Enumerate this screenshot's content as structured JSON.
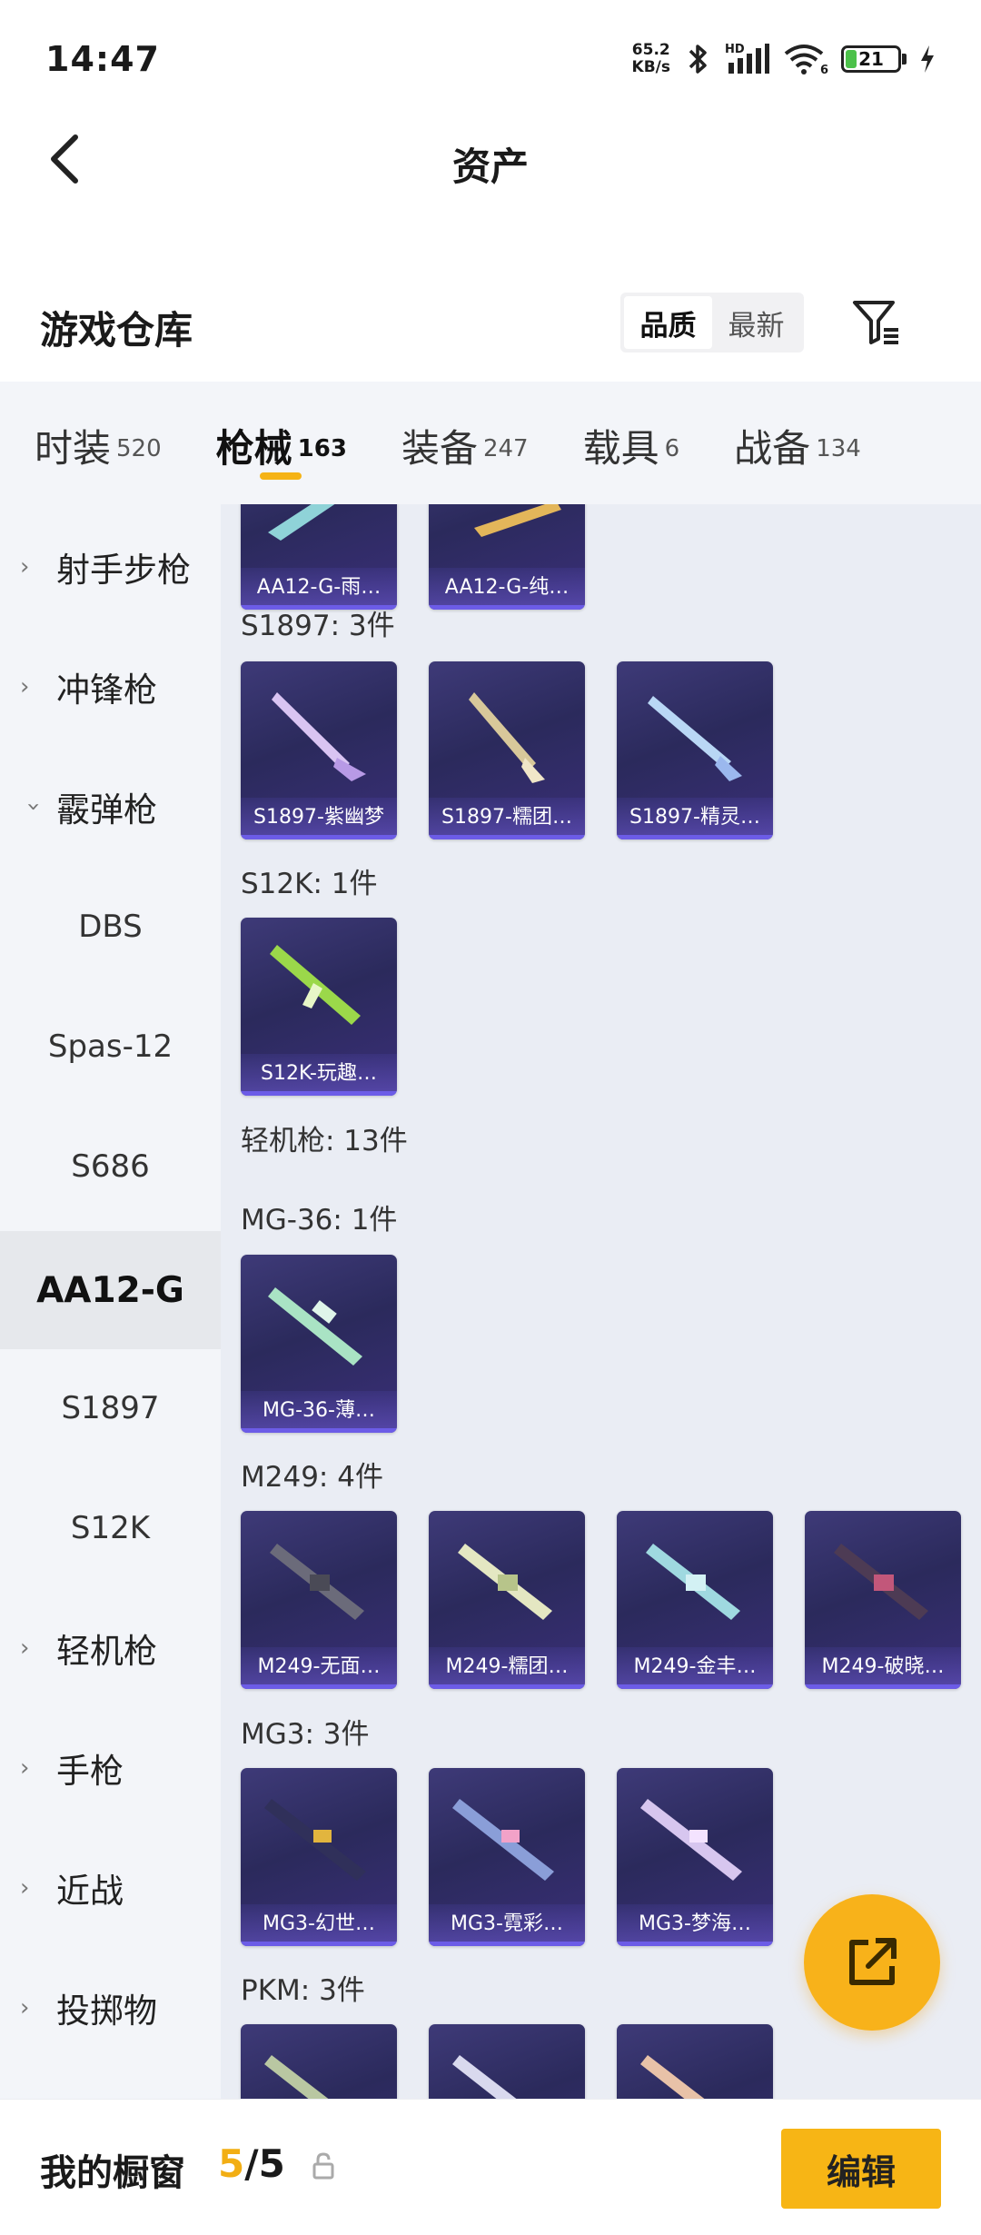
{
  "status": {
    "time": "14:47",
    "net_speed_value": "65.2",
    "net_speed_unit": "KB/s",
    "signal_label": "HD",
    "wifi_label": "6",
    "battery": "21",
    "battery_level": 0.21
  },
  "nav": {
    "title": "资产"
  },
  "warehouse": {
    "title": "游戏仓库",
    "sort_options": [
      "品质",
      "最新"
    ],
    "sort_active": "品质"
  },
  "tabs": [
    {
      "label": "时装",
      "count": "520"
    },
    {
      "label": "枪械",
      "count": "163",
      "active": true
    },
    {
      "label": "装备",
      "count": "247"
    },
    {
      "label": "载具",
      "count": "6"
    },
    {
      "label": "战备",
      "count": "134"
    }
  ],
  "sidebar": {
    "items": [
      {
        "label": "射手步枪",
        "group": true
      },
      {
        "label": "冲锋枪",
        "group": true
      },
      {
        "label": "霰弹枪",
        "group": true,
        "expanded": true
      },
      {
        "label": "DBS"
      },
      {
        "label": "Spas-12"
      },
      {
        "label": "S686"
      },
      {
        "label": "AA12-G",
        "active": true
      },
      {
        "label": "S1897"
      },
      {
        "label": "S12K"
      },
      {
        "label": "轻机枪",
        "group": true
      },
      {
        "label": "手枪",
        "group": true
      },
      {
        "label": "近战",
        "group": true
      },
      {
        "label": "投掷物",
        "group": true
      }
    ]
  },
  "content": {
    "top_cards": [
      "AA12-G-雨…",
      "AA12-G-纯…"
    ],
    "sections": [
      {
        "label": "S1897: 3件",
        "cards": [
          "S1897-紫幽梦",
          "S1897-糯团…",
          "S1897-精灵…"
        ]
      },
      {
        "label": "S12K: 1件",
        "cards": [
          "S12K-玩趣…"
        ]
      },
      {
        "label": "轻机枪: 13件",
        "cards": []
      },
      {
        "label": "MG-36: 1件",
        "cards": [
          "MG-36-薄…"
        ]
      },
      {
        "label": "M249: 4件",
        "cards": [
          "M249-无面…",
          "M249-糯团…",
          "M249-金丰…",
          "M249-破晓…"
        ]
      },
      {
        "label": "MG3: 3件",
        "cards": [
          "MG3-幻世…",
          "MG3-霓彩…",
          "MG3-梦海…"
        ]
      },
      {
        "label": "PKM: 3件",
        "cards": [
          "",
          "",
          ""
        ]
      }
    ]
  },
  "bottom": {
    "title": "我的橱窗",
    "current": "5",
    "total": "/5",
    "edit_label": "编辑"
  },
  "colors": {
    "accent": "#f7b515",
    "card_bg": "#2f2c66",
    "sidebar_bg": "#f3f5f9",
    "content_bg": "#eaedf4"
  },
  "icons": {
    "back": "chevron-left-icon",
    "filter": "filter-icon",
    "share": "share-external-icon",
    "lock": "lock-icon",
    "bluetooth": "bluetooth-icon",
    "signal": "cell-signal-icon",
    "wifi": "wifi-icon",
    "charging": "lightning-icon"
  }
}
